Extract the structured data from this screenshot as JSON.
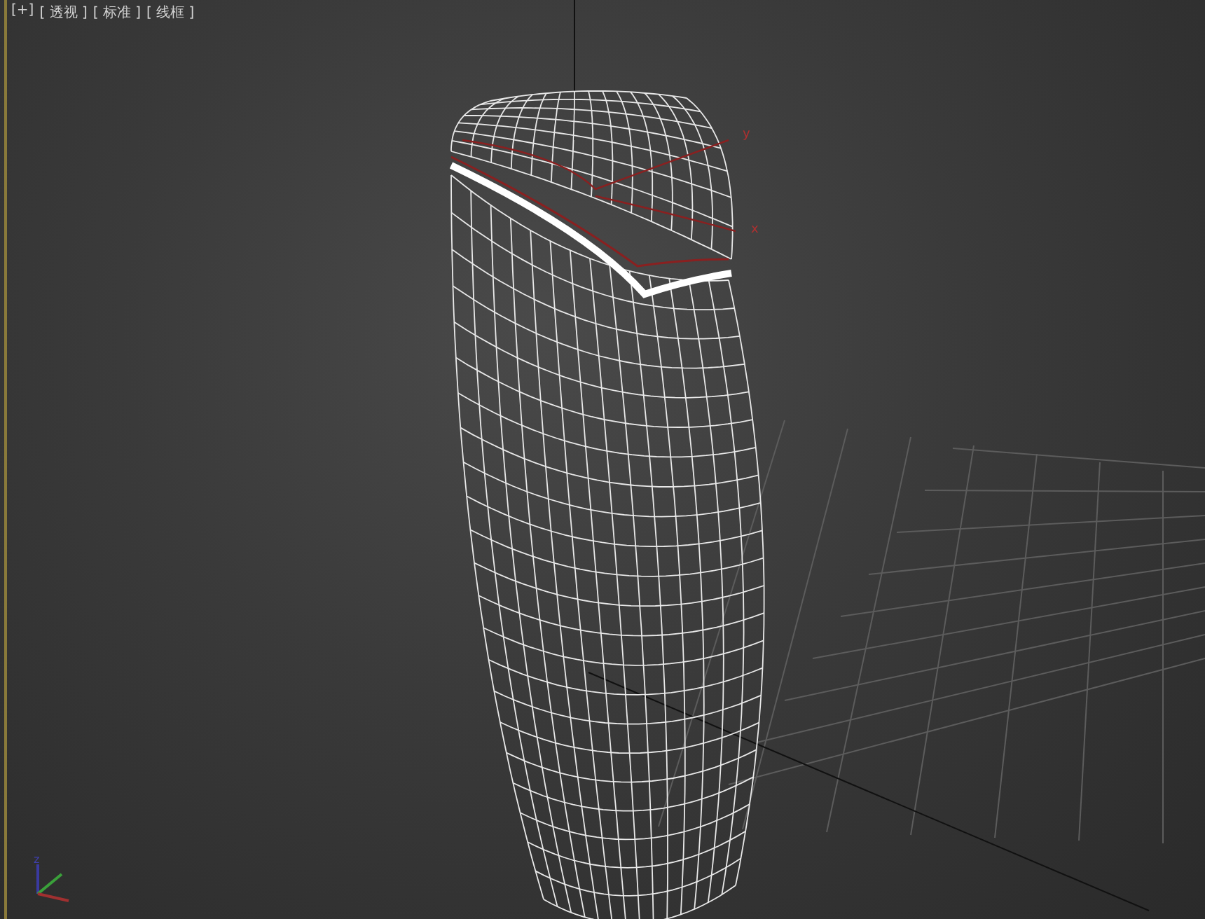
{
  "viewport": {
    "labels": [
      "[+]",
      "[ 透视 ]",
      "[ 标准 ]",
      "[ 线框 ]"
    ],
    "gizmo_axes": [
      "y",
      "x"
    ],
    "tripod_axis": "z"
  }
}
